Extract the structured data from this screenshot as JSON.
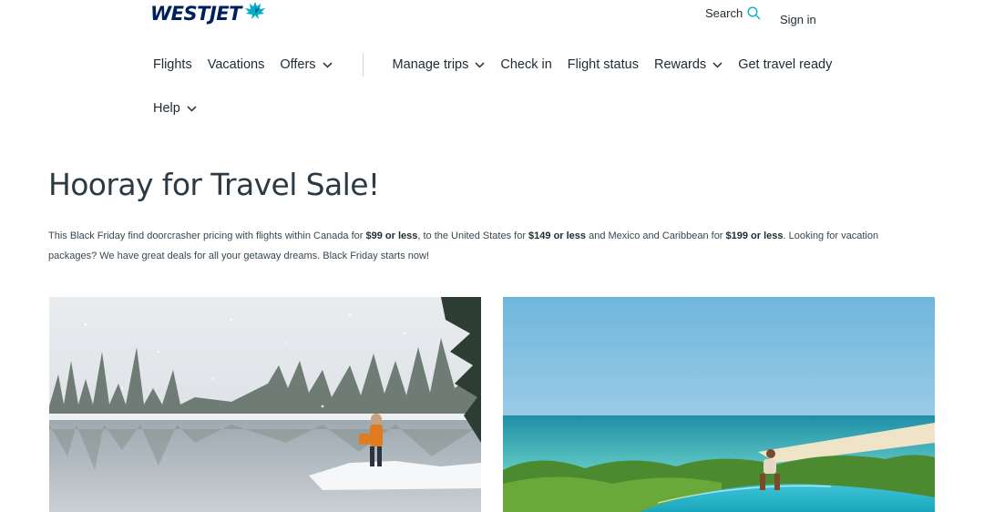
{
  "brand": {
    "name": "WESTJET",
    "color": "#00205b",
    "accent": "#00aec7"
  },
  "header": {
    "search_label": "Search",
    "signin_label": "Sign in"
  },
  "nav": {
    "items": [
      {
        "label": "Flights"
      },
      {
        "label": "Vacations"
      },
      {
        "label": "Offers"
      },
      {
        "label": "Manage trips"
      },
      {
        "label": "Check in"
      },
      {
        "label": "Flight status"
      },
      {
        "label": "Rewards"
      },
      {
        "label": "Get travel ready"
      },
      {
        "label": "Help"
      }
    ]
  },
  "main": {
    "title": "Hooray for Travel Sale!",
    "intro": {
      "p1": "This Black Friday find doorcrasher pricing with flights within Canada for ",
      "b1": "$99 or less",
      "p2": ", to the United States for ",
      "b2": "$149 or less",
      "p3": " and Mexico and Caribbean for ",
      "b3": "$199 or less",
      "p4": ". Looking for vacation packages? We have great deals for all your getaway dreams. Black Friday starts now!"
    }
  }
}
